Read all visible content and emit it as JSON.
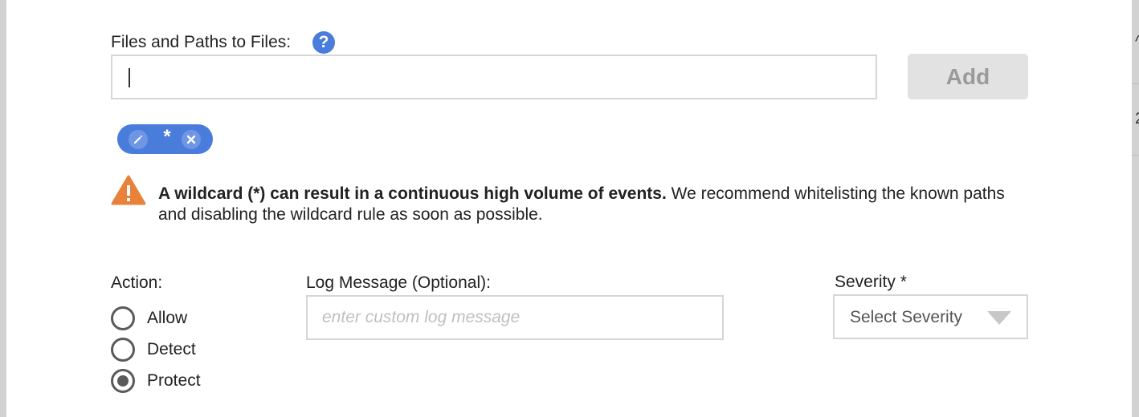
{
  "files": {
    "label": "Files and Paths to Files:",
    "help_icon": "question-mark-icon",
    "input_value": "",
    "add_label": "Add"
  },
  "chips": [
    {
      "text": "*",
      "edit_icon": "pencil-icon",
      "remove_icon": "close-icon"
    }
  ],
  "warning": {
    "icon": "warning-triangle-icon",
    "bold_text": "A wildcard (*) can result in a continuous high volume of events.",
    "text": " We recommend whitelisting the known paths and disabling the wildcard rule as soon as possible."
  },
  "action": {
    "label": "Action:",
    "options": [
      {
        "label": "Allow",
        "checked": false
      },
      {
        "label": "Detect",
        "checked": false
      },
      {
        "label": "Protect",
        "checked": true
      }
    ]
  },
  "log_message": {
    "label": "Log Message (Optional):",
    "placeholder": "enter custom log message",
    "value": ""
  },
  "severity": {
    "label": "Severity *",
    "selected": "Select Severity"
  },
  "colors": {
    "accent": "#4a7cdc",
    "warning": "#e8823a",
    "disabled_button": "#e2e2e2"
  }
}
